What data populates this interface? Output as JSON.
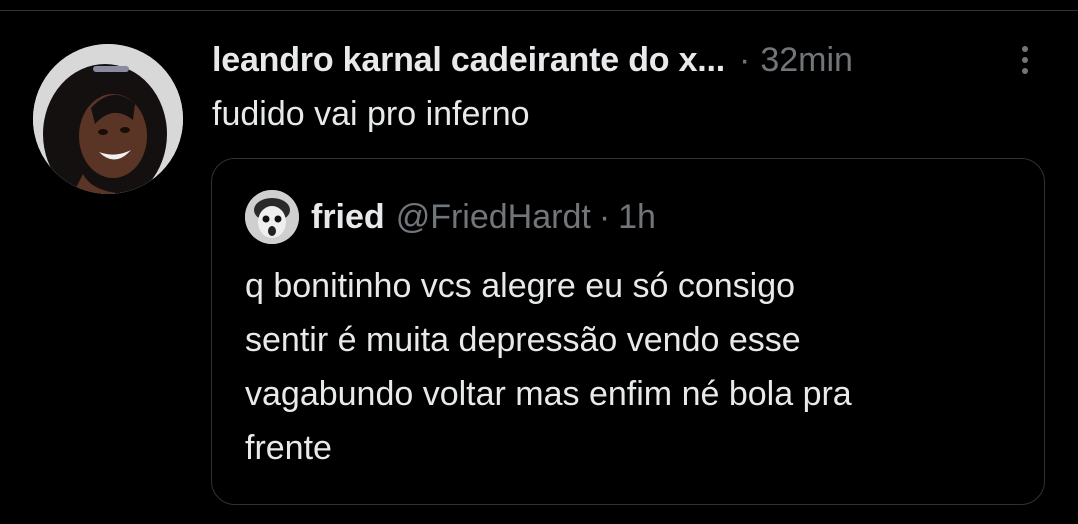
{
  "tweet": {
    "display_name": "leandro karnal cadeirante do x...",
    "separator": "·",
    "timestamp": "32min",
    "text": "fudido vai pro inferno",
    "more_icon": "more-vertical-icon",
    "avatar_icon": "user-avatar-photo"
  },
  "quoted_tweet": {
    "display_name": "fried",
    "handle": "@FriedHardt",
    "separator": "·",
    "timestamp": "1h",
    "avatar_icon": "user-avatar-photo",
    "text_lines": [
      "q bonitinho vcs alegre eu só consigo",
      "sentir é muita depressão vendo esse",
      "vagabundo voltar mas enfim né bola pra",
      "frente"
    ]
  },
  "colors": {
    "background": "#000000",
    "primary_text": "#e7e9ea",
    "secondary_text": "#71767b",
    "border": "#2f3336"
  }
}
